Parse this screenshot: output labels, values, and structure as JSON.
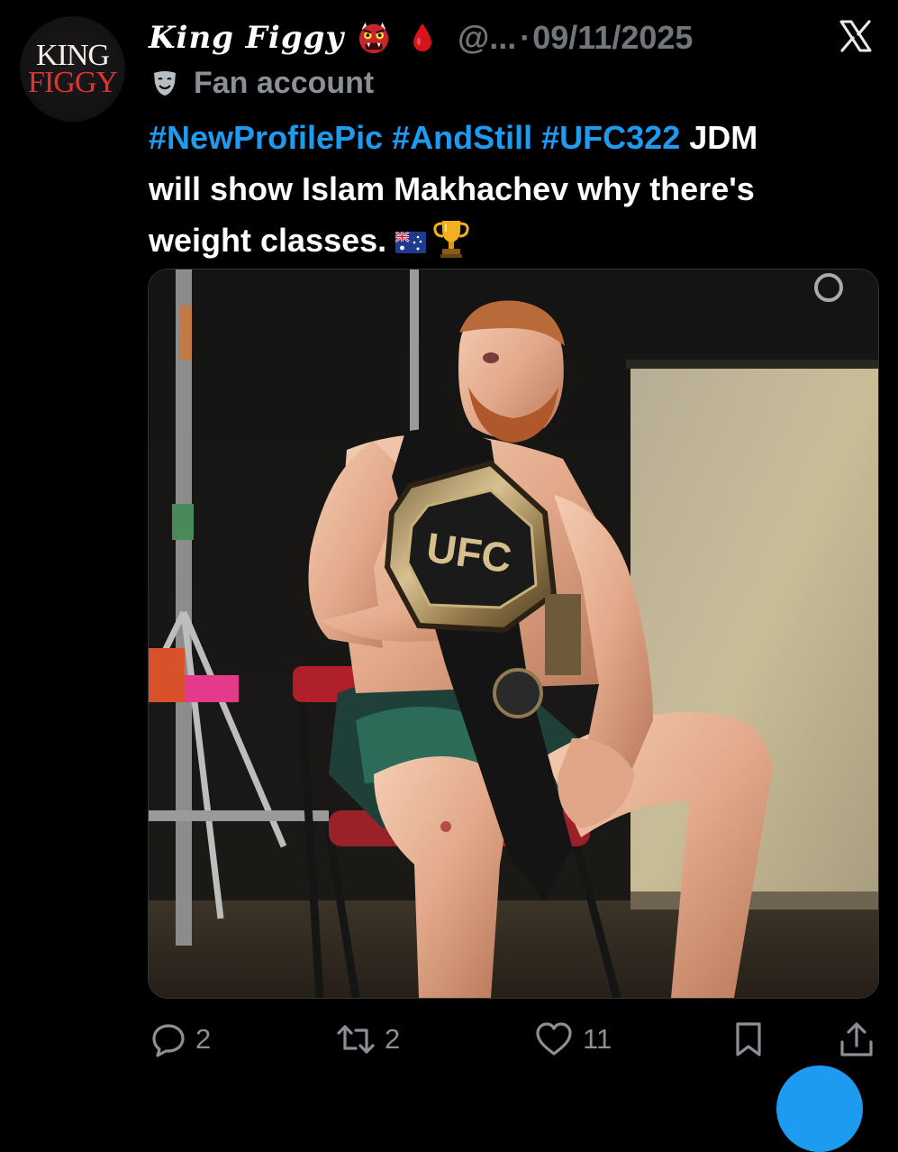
{
  "avatar": {
    "line1": "KING",
    "line2": "FIGGY"
  },
  "header": {
    "display_name": "King Figgy",
    "handle": "@...",
    "separator": "·",
    "date": "09/11/2025"
  },
  "subline": {
    "label": "Fan account"
  },
  "tweet": {
    "hashtags": [
      "#NewProfilePic",
      "#AndStill",
      "#UFC322"
    ],
    "body_line1": "JDM",
    "body_line2": "will show Islam Makhachev why there's",
    "body_line3": "weight classes."
  },
  "media": {
    "belt_text": "UFC"
  },
  "actions": {
    "reply_count": "2",
    "repost_count": "2",
    "like_count": "11"
  },
  "icons": {
    "x_logo": "x-logo-icon",
    "reply": "reply-icon",
    "repost": "repost-icon",
    "like": "heart-icon",
    "bookmark": "bookmark-icon",
    "share": "share-icon",
    "badge1": "ogre-emoji-icon",
    "badge2": "blood-drop-icon",
    "fan": "theater-mask-icon"
  },
  "colors": {
    "background": "#000000",
    "text": "#ffffff",
    "muted": "#71767b",
    "link": "#1d9bf0"
  }
}
